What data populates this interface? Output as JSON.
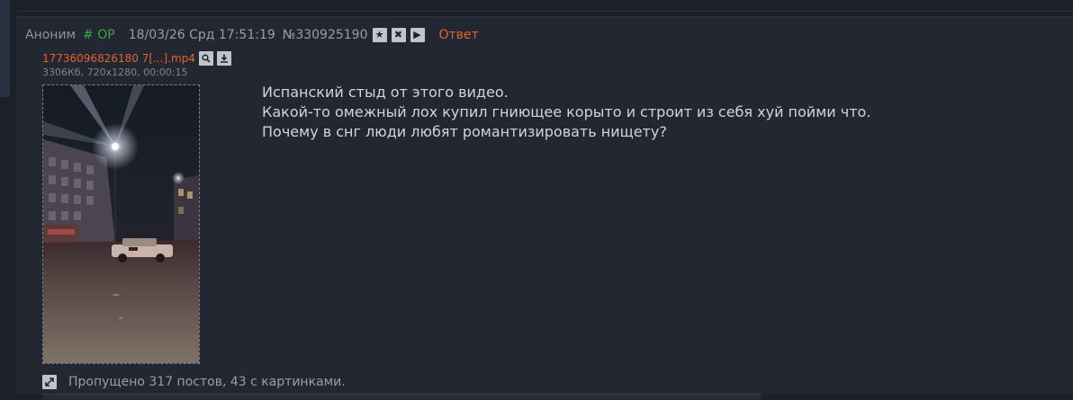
{
  "post": {
    "author": "Аноним",
    "op_tag": "# OP",
    "date": "18/03/26 Срд 17:51:19",
    "number": "№330925190",
    "reply_label": "Ответ",
    "header_icons": [
      "star-icon",
      "close-icon",
      "play-icon"
    ]
  },
  "file": {
    "name": "17736096826180 7[...].mp4",
    "meta": "3306Кб, 720x1280, 00:00:15",
    "icons": [
      "search-icon",
      "download-icon"
    ]
  },
  "message": {
    "lines": [
      "Испанский стыд от этого видео.",
      "Какой-то омежный лох купил гниющее корыто и строит из себя хуй пойми что.",
      "Почему в снг люди любят романтизировать нищету?"
    ]
  },
  "omitted": {
    "text": "Пропущено 317 постов, 43 с картинками."
  },
  "colors": {
    "background": "#1c2029",
    "post_background": "#222732",
    "accent_orange": "#e0642c",
    "op_green": "#3ea63e"
  }
}
